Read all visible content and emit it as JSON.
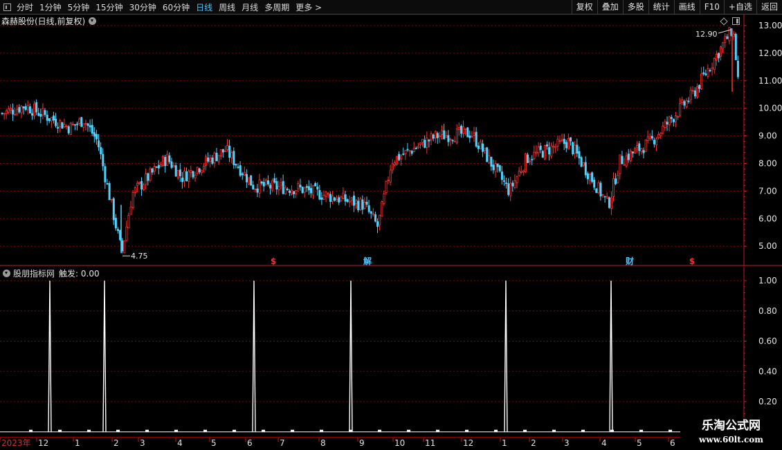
{
  "toolbar": {
    "periods": [
      "分时",
      "1分钟",
      "5分钟",
      "15分钟",
      "30分钟",
      "60分钟",
      "日线",
      "周线",
      "月线",
      "多周期",
      "更多 >"
    ],
    "active_period": "日线",
    "right_buttons": [
      "复权",
      "叠加",
      "多股",
      "统计",
      "画线",
      "F10",
      "+自选",
      "返回"
    ]
  },
  "price_panel": {
    "title": "森赫股份(日线,前复权)",
    "y_ticks": [
      "13.00",
      "12.00",
      "11.00",
      "10.00",
      "9.00",
      "8.00",
      "7.00",
      "6.00",
      "5.00"
    ],
    "high_label": "12.90",
    "low_label": "4.75",
    "markers": [
      {
        "text": "$",
        "color": "#ff3030"
      },
      {
        "text": "解",
        "color": "#4fc3f7"
      },
      {
        "text": "财",
        "color": "#4fc3f7"
      },
      {
        "text": "$",
        "color": "#ff3030"
      }
    ],
    "colors": {
      "up": "#ff3333",
      "down": "#4fd4ff",
      "grid": "#8b0000",
      "axis": "#c81e1e"
    }
  },
  "indicator_panel": {
    "name": "股朋指标网",
    "trigger_label": "触发: 0.00",
    "y_ticks": [
      "1.00",
      "0.80",
      "0.60",
      "0.40",
      "0.20"
    ]
  },
  "date_axis": {
    "labels": [
      "2023年",
      "12",
      "1",
      "2",
      "3",
      "4",
      "5",
      "6",
      "7",
      "8",
      "9",
      "10",
      "11",
      "12",
      "1",
      "2",
      "3",
      "4",
      "5",
      "6"
    ]
  },
  "watermark": {
    "title": "乐淘公式网",
    "url": "www.60lt.com"
  },
  "chart_data": {
    "type": "candlestick",
    "title": "森赫股份(日线,前复权)",
    "price_range": [
      4.75,
      12.9
    ],
    "price_axis_ticks": [
      5,
      6,
      7,
      8,
      9,
      10,
      11,
      12,
      13
    ],
    "path_keypoints": [
      {
        "date": "2022-12",
        "price": 9.8
      },
      {
        "date": "2023-01",
        "price": 10.1
      },
      {
        "date": "2023-01",
        "price": 9.3
      },
      {
        "date": "2023-02",
        "price": 9.6
      },
      {
        "date": "2023-03",
        "price": 8.8
      },
      {
        "date": "2023-03",
        "price": 4.75
      },
      {
        "date": "2023-04",
        "price": 6.9
      },
      {
        "date": "2023-04",
        "price": 8.2
      },
      {
        "date": "2023-05",
        "price": 7.5
      },
      {
        "date": "2023-06",
        "price": 8.5
      },
      {
        "date": "2023-07",
        "price": 7.2
      },
      {
        "date": "2023-08",
        "price": 7.1
      },
      {
        "date": "2023-09",
        "price": 6.5
      },
      {
        "date": "2023-09",
        "price": 5.7
      },
      {
        "date": "2023-10",
        "price": 8.1
      },
      {
        "date": "2023-11",
        "price": 9.0
      },
      {
        "date": "2023-12",
        "price": 9.1
      },
      {
        "date": "2024-01",
        "price": 7.0
      },
      {
        "date": "2024-01",
        "price": 8.2
      },
      {
        "date": "2024-03",
        "price": 8.8
      },
      {
        "date": "2024-04",
        "price": 6.5
      },
      {
        "date": "2024-04",
        "price": 8.1
      },
      {
        "date": "2024-05",
        "price": 8.8
      },
      {
        "date": "2024-06",
        "price": 10.5
      },
      {
        "date": "2024-06",
        "price": 12.9
      },
      {
        "date": "2024-06",
        "price": 10.9
      }
    ],
    "indicator": {
      "name": "股朋指标网",
      "range": [
        0,
        1.0
      ],
      "signals": [
        {
          "date": "2022-12",
          "value": 1.0
        },
        {
          "date": "2023-02",
          "value": 1.0
        },
        {
          "date": "2023-06",
          "value": 1.0
        },
        {
          "date": "2023-09",
          "value": 1.0
        },
        {
          "date": "2024-01",
          "value": 1.0
        },
        {
          "date": "2024-04",
          "value": 1.0
        }
      ]
    }
  }
}
